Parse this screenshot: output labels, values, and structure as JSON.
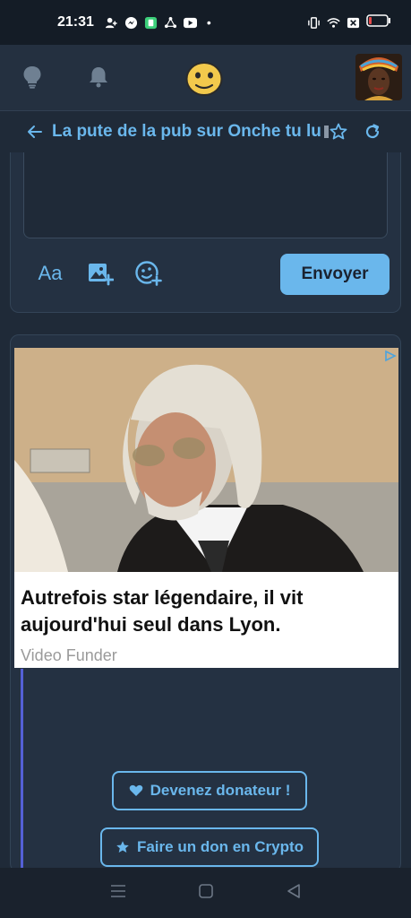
{
  "status_bar": {
    "time": "21:31",
    "dot": "•"
  },
  "nav": {
    "idea": "lightbulb-icon",
    "notifications": "bell-icon",
    "logo": "smiley-logo",
    "avatar": "user-avatar"
  },
  "topic": {
    "title": "La pute de la pub sur Onche tu lui"
  },
  "composer": {
    "font_button": "Aa",
    "send_label": "Envoyer"
  },
  "ad": {
    "headline": "Autrefois star légendaire, il vit aujourd'hui seul dans Lyon.",
    "source": "Video Funder"
  },
  "donate": {
    "donor_label": "Devenez donateur !",
    "crypto_label": "Faire un don en Crypto"
  },
  "colors": {
    "accent": "#6ab7ec",
    "background": "#1f2a38",
    "panel": "#243142"
  }
}
